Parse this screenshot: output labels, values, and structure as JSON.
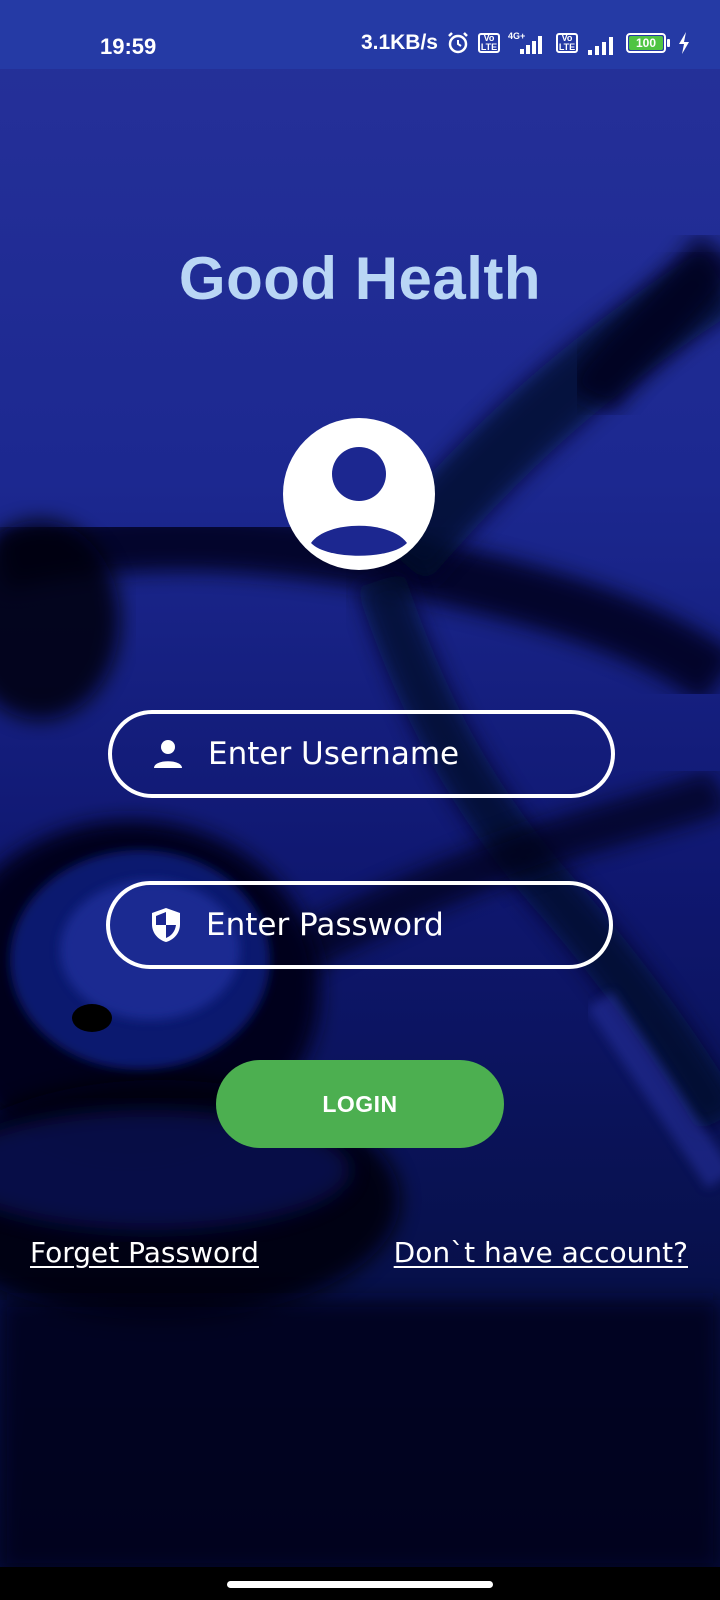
{
  "status_bar": {
    "time": "19:59",
    "net_speed": "3.1KB/s",
    "alarm_icon": "alarm-clock-icon",
    "volte_label": "Vo\nLTE",
    "network_type": "4G+",
    "battery_level": "100",
    "charging_icon": "lightning-bolt-icon"
  },
  "app": {
    "title": "Good Health"
  },
  "login_form": {
    "avatar_icon": "user-avatar-icon",
    "username": {
      "icon": "person-icon",
      "placeholder": "Enter Username",
      "value": ""
    },
    "password": {
      "icon": "shield-icon",
      "placeholder": "Enter Password",
      "value": ""
    },
    "login_button": "LOGIN",
    "forget_password_link": "Forget Password",
    "signup_link": "Don`t have account?"
  },
  "colors": {
    "background_top": "#26319a",
    "background_bottom": "#050a35",
    "status_bar": "#253aa5",
    "title": "#b9d6f5",
    "login_button": "#4caf50",
    "battery_fill": "#4fc443"
  }
}
